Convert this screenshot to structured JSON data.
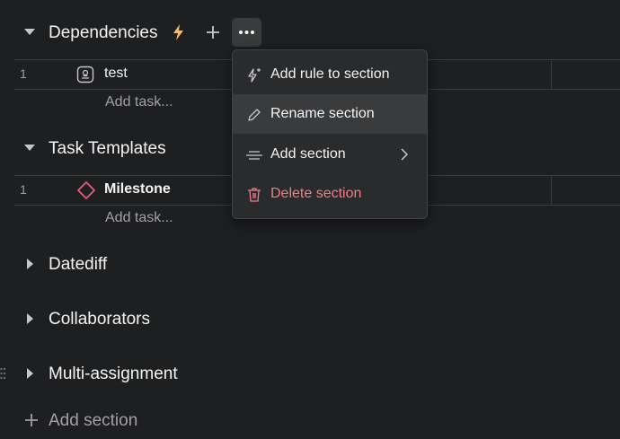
{
  "sections": {
    "dependencies": {
      "title": "Dependencies",
      "expanded": true
    },
    "task_templates": {
      "title": "Task Templates",
      "expanded": true
    },
    "datediff": {
      "title": "Datediff",
      "expanded": false
    },
    "collaborators": {
      "title": "Collaborators",
      "expanded": false
    },
    "multi_assignment": {
      "title": "Multi-assignment",
      "expanded": false
    }
  },
  "tasks": {
    "dep_task": {
      "num": "1",
      "name": "test",
      "icon": "approval-icon"
    },
    "tmpl_task": {
      "num": "1",
      "name": "Milestone",
      "icon": "milestone-diamond-icon"
    }
  },
  "add_task_label": "Add task...",
  "add_section_label": "Add section",
  "menu": {
    "items": [
      {
        "label": "Add rule to section",
        "icon": "lightning-sparkle-icon"
      },
      {
        "label": "Rename section",
        "icon": "pencil-icon"
      },
      {
        "label": "Add section",
        "icon": "section-lines-icon"
      },
      {
        "label": "Delete section",
        "icon": "trash-icon"
      }
    ]
  },
  "colors": {
    "background": "#1e1f21",
    "menu_bg": "#2a2b2d",
    "danger": "#ec7e8b",
    "lightning": "#f1bd6c",
    "milestone": "#e8607c"
  }
}
